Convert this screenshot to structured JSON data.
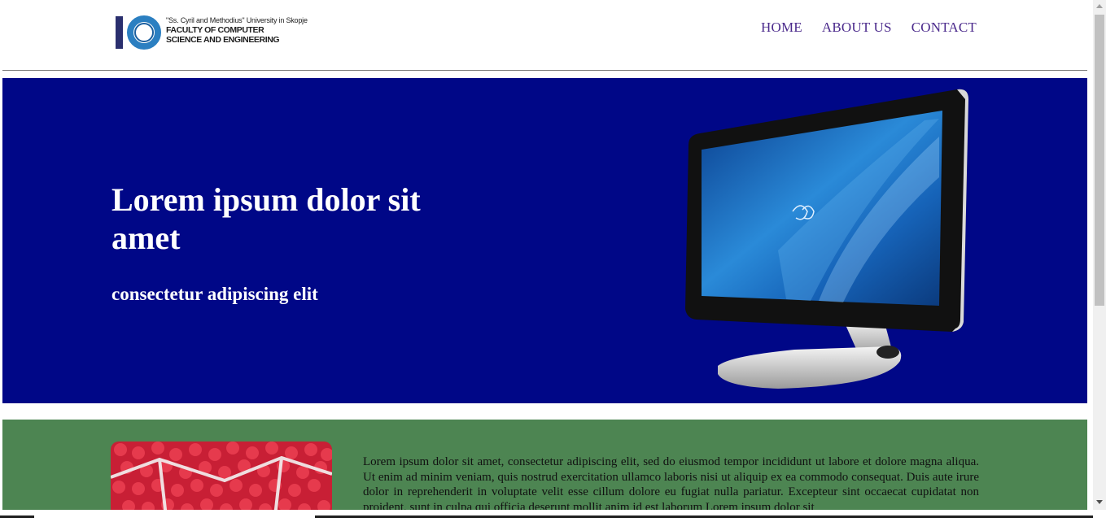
{
  "header": {
    "logo": {
      "university": "\"Ss. Cyril and Methodius\" University in Skopje",
      "faculty_line1": "FACULTY OF COMPUTER",
      "faculty_line2": "SCIENCE AND ENGINEERING"
    },
    "nav": [
      "HOME",
      "ABOUT US",
      "CONTACT"
    ]
  },
  "hero": {
    "title": "Lorem ipsum dolor sit amet",
    "subtitle": "consectetur adipiscing elit",
    "background_color": "#000787",
    "image": "desktop-monitor-image"
  },
  "section": {
    "background_color": "#4d8552",
    "image": "raspberries-image",
    "paragraph": "Lorem ipsum dolor sit amet, consectetur adipiscing elit, sed do eiusmod tempor incididunt ut labore et dolore magna aliqua. Ut enim ad minim veniam, quis nostrud exercitation ullamco laboris nisi ut aliquip ex ea commodo consequat. Duis aute irure dolor in reprehenderit in voluptate velit esse cillum dolore eu fugiat nulla pariatur. Excepteur sint occaecat cupidatat non proident, sunt in culpa qui officia deserunt mollit anim id est laborum Lorem ipsum dolor sit"
  },
  "colors": {
    "nav_link": "#4b2a8c",
    "logo_blue": "#2b7fc1",
    "logo_navy": "#2a2f6e"
  }
}
